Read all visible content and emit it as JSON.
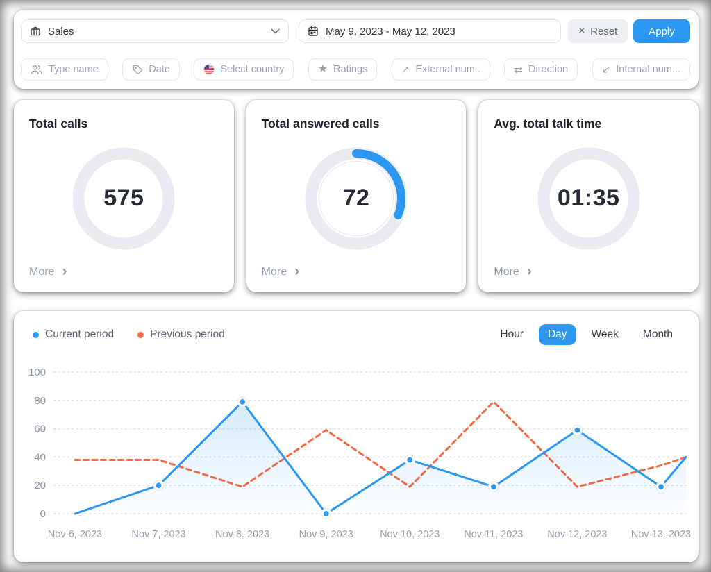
{
  "toolbar": {
    "team_select": {
      "icon": "briefcase-icon",
      "value": "Sales"
    },
    "date_range": {
      "icon": "calendar-icon",
      "value": "May 9, 2023 - May 12, 2023"
    },
    "reset_label": "Reset",
    "apply_label": "Apply"
  },
  "filters": [
    {
      "icon": "users-icon",
      "label": "Type name"
    },
    {
      "icon": "tag-icon",
      "label": "Date"
    },
    {
      "icon": "us-flag-icon",
      "label": "Select country"
    },
    {
      "icon": "star-icon",
      "label": "Ratings"
    },
    {
      "icon": "arrow-up-right-icon",
      "label": "External num.."
    },
    {
      "icon": "arrows-swap-icon",
      "label": "Direction"
    },
    {
      "icon": "arrow-down-left-icon",
      "label": "Internal num..."
    }
  ],
  "stats": [
    {
      "title": "Total calls",
      "value": "575",
      "more_label": "More",
      "progress": 0
    },
    {
      "title": "Total answered calls",
      "value": "72",
      "more_label": "More",
      "progress": 0.31
    },
    {
      "title": "Avg. total talk time",
      "value": "01:35",
      "more_label": "More",
      "progress": 0
    }
  ],
  "chart": {
    "legend": [
      {
        "label": "Current period",
        "color": "#2b97f1"
      },
      {
        "label": "Previous period",
        "color": "#f9683f"
      }
    ],
    "tabs": [
      {
        "label": "Hour",
        "active": false
      },
      {
        "label": "Day",
        "active": true
      },
      {
        "label": "Week",
        "active": false
      },
      {
        "label": "Month",
        "active": false
      }
    ]
  },
  "chart_data": {
    "type": "line",
    "x_labels": [
      "Nov 6, 2023",
      "Nov 7, 2023",
      "Nov 8, 2023",
      "Nov 9, 2023",
      "Nov 10, 2023",
      "Nov 11, 2023",
      "Nov 12, 2023",
      "Nov 13, 2023"
    ],
    "yticks": [
      0,
      20,
      40,
      60,
      80,
      100
    ],
    "ylim": [
      0,
      100
    ],
    "grid": "horizontal-dotted",
    "legend_position": "top-left",
    "series": [
      {
        "name": "Current period",
        "color": "#2b97f1",
        "line_style": "solid",
        "area_fill": true,
        "markers": true,
        "values": [
          0,
          20,
          79,
          0,
          38,
          19,
          59,
          19
        ],
        "edge_value": 40
      },
      {
        "name": "Previous period",
        "color": "#f9683f",
        "line_style": "dashed",
        "area_fill": false,
        "markers": false,
        "values": [
          38,
          38,
          19,
          59,
          19,
          79,
          19,
          34
        ],
        "edge_value": 40
      }
    ]
  },
  "colors": {
    "accent_blue": "#2b97f1",
    "accent_orange": "#f9683f",
    "ring_gray": "#e9ebf0"
  }
}
